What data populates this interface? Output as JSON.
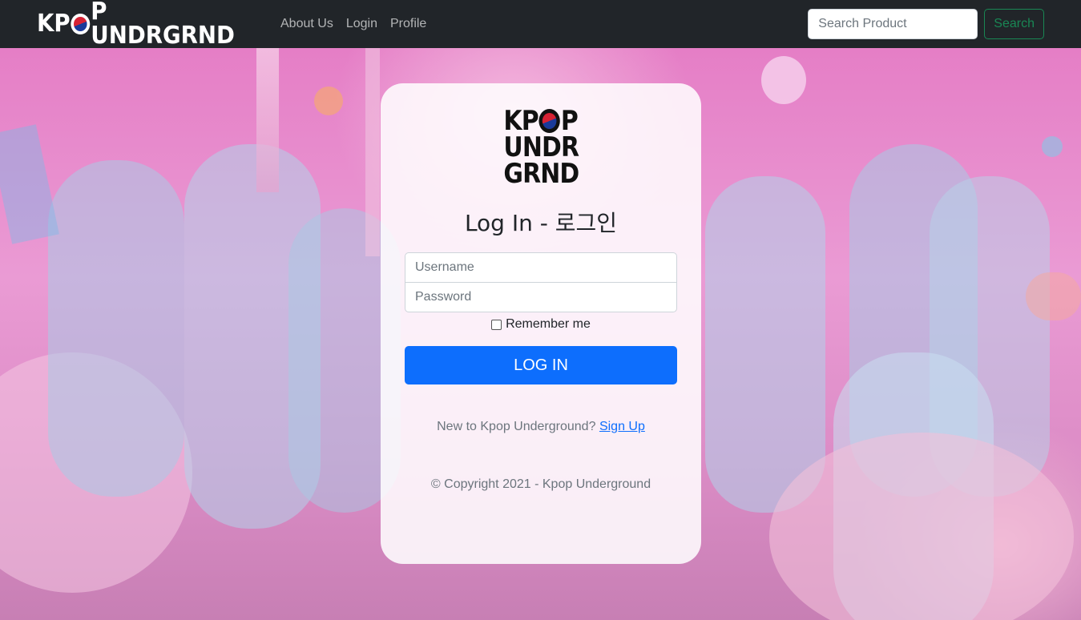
{
  "navbar": {
    "brand_pre": "K",
    "brand_letter_p": "P",
    "brand_post": "P UNDRGRND",
    "links": [
      "About Us",
      "Login",
      "Profile"
    ],
    "search_placeholder": "Search Product",
    "search_button": "Search"
  },
  "login": {
    "logo_row1_pre": "K",
    "logo_row1_p": "P",
    "logo_row1_post": "P",
    "logo_row2": "UNDR",
    "logo_row3": "GRND",
    "title": "Log In - 로그인",
    "username_placeholder": "Username",
    "password_placeholder": "Password",
    "remember_label": "Remember me",
    "login_button": "LOG IN",
    "signup_prompt": "New to Kpop Underground?",
    "signup_link": "Sign Up",
    "copyright": "© Copyright 2021 - Kpop Underground"
  },
  "colors": {
    "navbar_bg": "#212529",
    "primary": "#0d6efd",
    "success": "#198754",
    "background": "#e79acb"
  }
}
